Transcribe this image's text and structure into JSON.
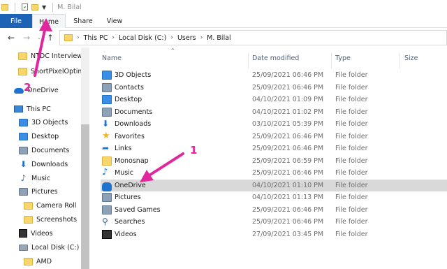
{
  "window": {
    "title": "M. Bilal"
  },
  "ribbon": {
    "file_label": "File",
    "tabs": [
      {
        "label": "Home"
      },
      {
        "label": "Share"
      },
      {
        "label": "View"
      }
    ]
  },
  "address": {
    "crumbs": [
      {
        "label": "This PC"
      },
      {
        "label": "Local Disk (C:)"
      },
      {
        "label": "Users"
      },
      {
        "label": "M. Bilal"
      }
    ]
  },
  "nav": {
    "items": [
      {
        "label": "NTDC Interview",
        "icon": "folder-icon"
      },
      {
        "label": "ShortPixelOptim",
        "icon": "folder-icon"
      },
      {
        "label": "OneDrive",
        "icon": "cloud-icon"
      },
      {
        "label": "This PC",
        "icon": "computer-icon"
      },
      {
        "label": "3D Objects",
        "icon": "cube-icon"
      },
      {
        "label": "Desktop",
        "icon": "desktop-icon"
      },
      {
        "label": "Documents",
        "icon": "document-icon"
      },
      {
        "label": "Downloads",
        "icon": "download-arrow-icon"
      },
      {
        "label": "Music",
        "icon": "music-note-icon"
      },
      {
        "label": "Pictures",
        "icon": "picture-icon"
      },
      {
        "label": "Camera Roll",
        "icon": "folder-icon"
      },
      {
        "label": "Screenshots",
        "icon": "folder-icon"
      },
      {
        "label": "Videos",
        "icon": "film-icon"
      },
      {
        "label": "Local Disk (C:)",
        "icon": "drive-icon"
      },
      {
        "label": "AMD",
        "icon": "folder-icon"
      }
    ]
  },
  "columns": {
    "name": "Name",
    "date": "Date modified",
    "type": "Type",
    "size": "Size"
  },
  "files": [
    {
      "name": "3D Objects",
      "date": "25/09/2021 06:46 PM",
      "type": "File folder",
      "icon": "cube-icon"
    },
    {
      "name": "Contacts",
      "date": "25/09/2021 06:46 PM",
      "type": "File folder",
      "icon": "contacts-icon"
    },
    {
      "name": "Desktop",
      "date": "04/10/2021 01:09 PM",
      "type": "File folder",
      "icon": "desktop-icon"
    },
    {
      "name": "Documents",
      "date": "04/10/2021 01:02 PM",
      "type": "File folder",
      "icon": "document-icon"
    },
    {
      "name": "Downloads",
      "date": "03/10/2021 05:39 PM",
      "type": "File folder",
      "icon": "download-arrow-icon"
    },
    {
      "name": "Favorites",
      "date": "25/09/2021 06:46 PM",
      "type": "File folder",
      "icon": "star-icon"
    },
    {
      "name": "Links",
      "date": "25/09/2021 06:46 PM",
      "type": "File folder",
      "icon": "link-arrow-icon"
    },
    {
      "name": "Monosnap",
      "date": "25/09/2021 06:59 PM",
      "type": "File folder",
      "icon": "folder-icon"
    },
    {
      "name": "Music",
      "date": "25/09/2021 06:46 PM",
      "type": "File folder",
      "icon": "music-note-icon"
    },
    {
      "name": "OneDrive",
      "date": "04/10/2021 01:10 PM",
      "type": "File folder",
      "icon": "cloud-icon"
    },
    {
      "name": "Pictures",
      "date": "04/10/2021 01:13 PM",
      "type": "File folder",
      "icon": "picture-icon"
    },
    {
      "name": "Saved Games",
      "date": "25/09/2021 06:46 PM",
      "type": "File folder",
      "icon": "gamepad-icon"
    },
    {
      "name": "Searches",
      "date": "25/09/2021 06:46 PM",
      "type": "File folder",
      "icon": "magnifier-icon"
    },
    {
      "name": "Videos",
      "date": "27/09/2021 03:45 PM",
      "type": "File folder",
      "icon": "film-icon"
    }
  ],
  "annotations": {
    "one": "1",
    "two": "2"
  },
  "colors": {
    "accent": "#1d63b5",
    "annotation": "#e0279e",
    "selection": "#d9d9d9"
  }
}
